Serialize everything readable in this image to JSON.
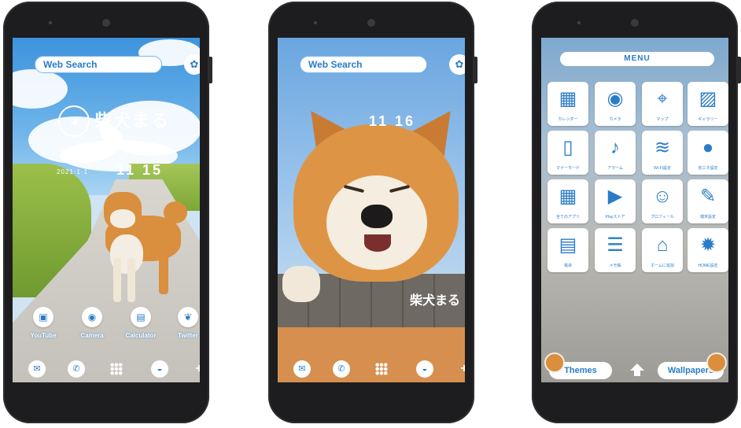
{
  "phone1": {
    "search_label": "Web Search",
    "paw_icon": "paw-icon",
    "logo_text": "柴犬まる",
    "clock_time": "11 15",
    "clock_date": "2021·1·1",
    "apps": [
      {
        "label": "YouTube",
        "icon": "youtube-icon"
      },
      {
        "label": "Camera",
        "icon": "camera-icon"
      },
      {
        "label": "Calculator",
        "icon": "calculator-icon"
      },
      {
        "label": "Twitter",
        "icon": "twitter-icon"
      }
    ],
    "dock": [
      "mail-icon",
      "phone-icon",
      "apps-grid-icon",
      "browser-icon",
      "plus-icon"
    ]
  },
  "phone2": {
    "search_label": "Web Search",
    "paw_icon": "paw-icon",
    "clock_time": "11 16",
    "caption": "柴犬まる",
    "dock": [
      "mail-icon",
      "phone-icon",
      "apps-grid-icon",
      "browser-icon",
      "plus-icon"
    ]
  },
  "phone3": {
    "menu_title": "MENU",
    "tiles": [
      {
        "label": "カレンダー",
        "icon": "calendar-icon",
        "glyph": "▦"
      },
      {
        "label": "カメラ",
        "icon": "camera-icon",
        "glyph": "◉"
      },
      {
        "label": "マップ",
        "icon": "map-pin-icon",
        "glyph": "⌖"
      },
      {
        "label": "ギャラリー",
        "icon": "gallery-icon",
        "glyph": "▨"
      },
      {
        "label": "マナーモード",
        "icon": "silent-mode-icon",
        "glyph": "▯"
      },
      {
        "label": "アラーム",
        "icon": "alarm-bell-icon",
        "glyph": "♪"
      },
      {
        "label": "Wi-Fi設定",
        "icon": "wifi-icon",
        "glyph": "≋"
      },
      {
        "label": "省エネ設定",
        "icon": "lightbulb-icon",
        "glyph": "●"
      },
      {
        "label": "全てのアプリ",
        "icon": "apps-grid-icon",
        "glyph": "▦"
      },
      {
        "label": "Playストア",
        "icon": "store-bag-icon",
        "glyph": "▶"
      },
      {
        "label": "プロフィール",
        "icon": "profile-icon",
        "glyph": "☺"
      },
      {
        "label": "端末設定",
        "icon": "wrench-icon",
        "glyph": "✎"
      },
      {
        "label": "電卓",
        "icon": "calculator-icon",
        "glyph": "▤"
      },
      {
        "label": "メモ帳",
        "icon": "notepad-icon",
        "glyph": "☰"
      },
      {
        "label": "ホームに追加",
        "icon": "home-icon",
        "glyph": "⌂"
      },
      {
        "label": "HOME設定",
        "icon": "home-settings-icon",
        "glyph": "✹"
      }
    ],
    "themes_label": "Themes",
    "wallpapers_label": "Wallpapers"
  }
}
